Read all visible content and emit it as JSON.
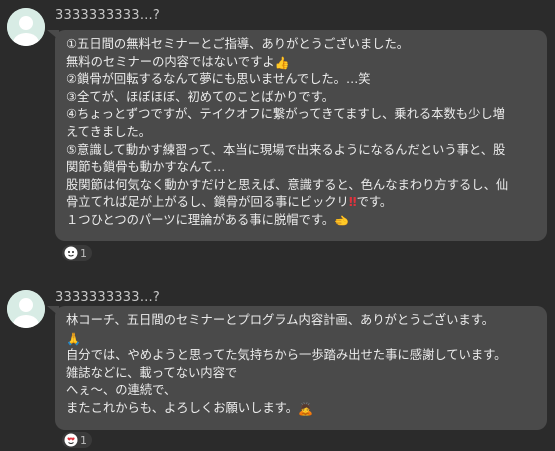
{
  "messages": [
    {
      "sender": "3333333333…?",
      "lines": [
        "①五日間の無料セミナーとご指導、ありがとうございました。",
        "無料のセミナーの内容ではないですよ",
        "②鎖骨が回転するなんて夢にも思いませんでした。…笑",
        "③全てが、ほぼほぼ、初めてのことばかりです。",
        "④ちょっとずつですが、テイクオフに繋がってきてますし、乗れる本数も少し増",
        "えてきました。",
        "⑤意識して動かす練習って、本当に現場で出来るようになるんだという事と、股",
        "関節も鎖骨も動かすなんて…",
        "股関節は何気なく動かすだけと思えば、意識すると、色んなまわり方するし、仙",
        "骨立てれば足が上がるし、鎖骨が回る事にビックリ",
        "１つひとつのパーツに理論がある事に脱帽です。"
      ],
      "inline_emoji": {
        "line2_end": "thumbs-up",
        "line10_marks": "‼",
        "line10_tail": "です。",
        "line11_end": "backhand-pointing"
      },
      "reaction": {
        "icon": "face-emoji",
        "count": "1"
      }
    },
    {
      "sender": "3333333333…?",
      "lines": [
        "林コーチ、五日間のセミナーとプログラム内容計画、ありがとうございます。",
        "自分では、やめようと思ってた気持ちから一歩踏み出せた事に感謝しています。",
        "雑誌などに、載ってない内容で",
        "へぇ〜、の連続で、",
        "またこれからも、よろしくお願いします。"
      ],
      "inline_emoji": {
        "line1_after": "folded-hands",
        "line5_end": "bowing-person"
      },
      "reaction": {
        "icon": "heart-face",
        "count": "1"
      }
    }
  ]
}
